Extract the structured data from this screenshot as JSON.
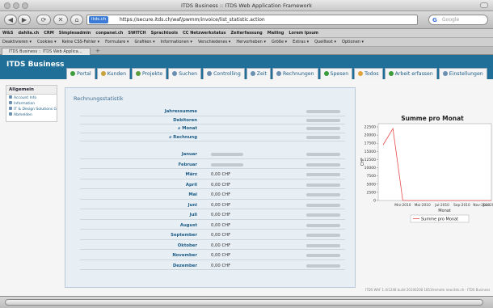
{
  "window": {
    "title": "ITDS Business :: ITDS Web Application Framework"
  },
  "toolbar": {
    "back": "◀",
    "forward": "▶",
    "reload": "⟳",
    "home": "⌂",
    "url_badge": "itds.ch",
    "url": "https://secure.itds.ch/waf/pwmm/invoice/list_statistic.action",
    "search_placeholder": "Google",
    "search_glyph": "G"
  },
  "bookmarks_row1": [
    "W&S",
    "dahlia.ch",
    "CRM",
    "Simplesadmin",
    "conpanel.ch",
    "SWITCH",
    "Sprachtools",
    "CC Netzwerkstatus",
    "Zeiterfassung",
    "Mailing",
    "Lorem Ipsum"
  ],
  "bookmarks_row2": [
    "Deaktivieren ▾",
    "Cookies ▾",
    "Keine CSS-Fehler ▾",
    "Formulare ▾",
    "Grafiken ▾",
    "Informationen ▾",
    "Verschiedenes ▾",
    "Hervorheben ▾",
    "Größe ▾",
    "Extras ▾",
    "Quelltext ▾",
    "Optionen ▾"
  ],
  "tab": {
    "label": "ITDS Business :: ITDS Web Applica..."
  },
  "app": {
    "title": "ITDS Business"
  },
  "nav": [
    {
      "label": "Portal",
      "color": "#3a9c3a"
    },
    {
      "label": "Kunden",
      "color": "#c8a23a"
    },
    {
      "label": "Projekte",
      "color": "#5c9c3c"
    },
    {
      "label": "Suchen",
      "color": "#6a8fb0"
    },
    {
      "label": "Controlling",
      "color": "#6a8fb0"
    },
    {
      "label": "Zeit",
      "color": "#6a8fb0"
    },
    {
      "label": "Rechnungen",
      "color": "#6a8fb0"
    },
    {
      "label": "Spesen",
      "color": "#3a9c3a"
    },
    {
      "label": "Todos",
      "color": "#e2a23a"
    },
    {
      "label": "Arbeit erfassen",
      "color": "#3a9c3a"
    },
    {
      "label": "Einstellungen",
      "color": "#6a8fb0"
    }
  ],
  "sidebar": {
    "heading": "Allgemein",
    "items": [
      "Account Info",
      "Information",
      "IT & Design Solutions GmbH",
      "Abmelden"
    ]
  },
  "panel": {
    "title": "Rechnungsstatistik",
    "summary": [
      {
        "label": "Jahressumme"
      },
      {
        "label": "Debitoren"
      },
      {
        "label": "⌀ Monat"
      },
      {
        "label": "⌀ Rechnung"
      }
    ],
    "months": [
      {
        "label": "Januar",
        "mid": ""
      },
      {
        "label": "Februar",
        "mid": ""
      },
      {
        "label": "März",
        "mid": "0,00 CHF"
      },
      {
        "label": "April",
        "mid": "0,00 CHF"
      },
      {
        "label": "Mai",
        "mid": "0,00 CHF"
      },
      {
        "label": "Juni",
        "mid": "0,00 CHF"
      },
      {
        "label": "Juli",
        "mid": "0,00 CHF"
      },
      {
        "label": "August",
        "mid": "0,00 CHF"
      },
      {
        "label": "September",
        "mid": "0,00 CHF"
      },
      {
        "label": "Oktober",
        "mid": "0,00 CHF"
      },
      {
        "label": "November",
        "mid": "0,00 CHF"
      },
      {
        "label": "Dezember",
        "mid": "0,00 CHF"
      }
    ]
  },
  "chart_data": {
    "type": "line",
    "title": "Summe pro Monat",
    "xlabel": "Monat",
    "ylabel": "CHF",
    "yticks": [
      "0",
      "2500",
      "5000",
      "7500",
      "10000",
      "12500",
      "15000",
      "17500",
      "20000",
      "22500"
    ],
    "xticks": [
      "Mrz-2010",
      "Mai-2010",
      "Jul-2010",
      "Sep-2010",
      "Nov-2010",
      "Jan-201"
    ],
    "ylim": [
      0,
      22500
    ],
    "series": [
      {
        "name": "Summe pro Monat",
        "color": "#e64b4b",
        "x": [
          "Jan-2010",
          "Feb-2010",
          "Mrz-2010",
          "Apr-2010",
          "Mai-2010",
          "Jun-2010",
          "Jul-2010",
          "Aug-2010",
          "Sep-2010",
          "Okt-2010",
          "Nov-2010",
          "Dez-2010"
        ],
        "values": [
          17000,
          22000,
          0,
          0,
          0,
          0,
          0,
          0,
          0,
          0,
          0,
          0
        ]
      }
    ],
    "legend": "bottom",
    "grid": false
  },
  "footer": {
    "note": "ITDS WAF 1.4/1248 build 20100208 1853/remote new.itds.ch - ITDS Business"
  }
}
